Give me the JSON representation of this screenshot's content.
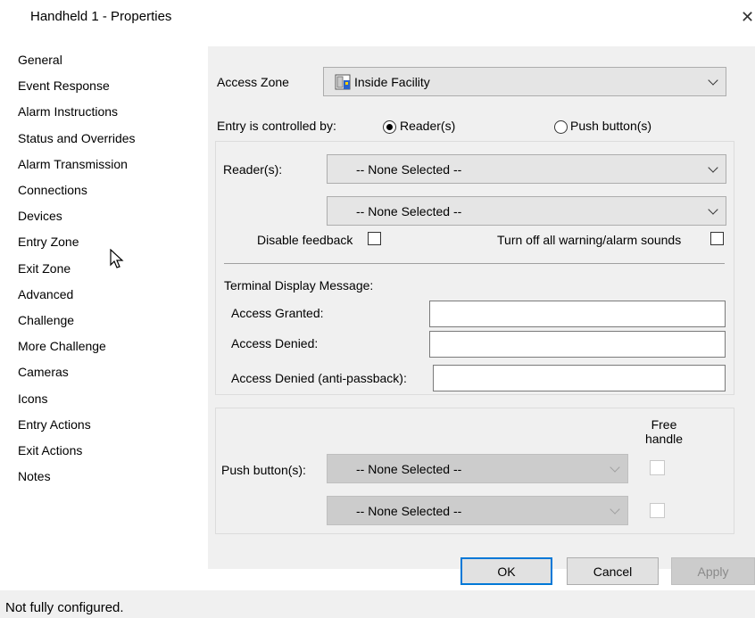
{
  "window": {
    "title": "Handheld 1 - Properties",
    "close": "✕"
  },
  "nav": {
    "items": [
      "General",
      "Event Response",
      "Alarm Instructions",
      "Status and Overrides",
      "Alarm Transmission",
      "Connections",
      "Devices",
      "Entry Zone",
      "Exit Zone",
      "Advanced",
      "Challenge",
      "More Challenge",
      "Cameras",
      "Icons",
      "Entry Actions",
      "Exit Actions",
      "Notes"
    ],
    "selected": "Entry Zone"
  },
  "access_zone": {
    "label": "Access Zone",
    "value": "Inside Facility"
  },
  "entry_control": {
    "label": "Entry is controlled by:",
    "reader_option": "Reader(s)",
    "push_option": "Push button(s)",
    "selected": "Reader(s)"
  },
  "readers": {
    "label": "Reader(s):",
    "reader1": "-- None Selected --",
    "reader2": "-- None Selected --",
    "disable_feedback": "Disable feedback",
    "turn_off_sounds": "Turn off all warning/alarm sounds"
  },
  "terminal": {
    "heading": "Terminal Display Message:",
    "granted_label": "Access Granted:",
    "denied_label": "Access Denied:",
    "antipassback_label": "Access Denied (anti-passback):"
  },
  "push_buttons": {
    "free_handle": "Free handle",
    "label": "Push button(s):",
    "button1": "-- None Selected --",
    "button2": "-- None Selected --"
  },
  "buttons": {
    "ok": "OK",
    "cancel": "Cancel",
    "apply": "Apply"
  },
  "status": {
    "text": "Not fully configured."
  }
}
